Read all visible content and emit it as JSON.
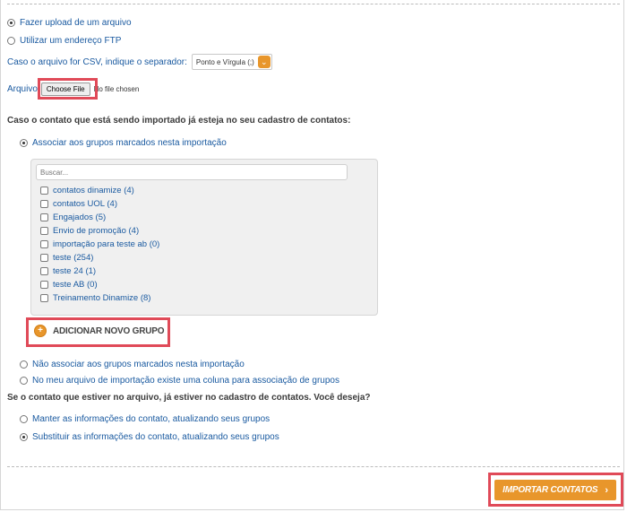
{
  "upload": {
    "option_upload": "Fazer upload de um arquivo",
    "option_ftp": "Utilizar um endereço FTP",
    "separator_label": "Caso o arquivo for CSV, indique o separador:",
    "separator_value": "Ponto e Vírgula (;)",
    "file_label": "Arquivo",
    "choose_file": "Choose File",
    "no_file": "No file chosen"
  },
  "existing_contact": {
    "question": "Caso o contato que está sendo importado já esteja no seu cadastro de contatos:",
    "option_associate": "Associar aos grupos marcados nesta importação",
    "search_placeholder": "Buscar...",
    "groups": [
      "contatos dinamize (4)",
      "contatos UOL (4)",
      "Engajados (5)",
      "Envio de promoção (4)",
      "importação para teste ab (0)",
      "teste (254)",
      "teste 24 (1)",
      "teste AB (0)",
      "Treinamento Dinamize (8)"
    ],
    "add_group": "ADICIONAR NOVO GRUPO",
    "option_no_associate": "Não associar aos grupos marcados nesta importação",
    "option_column": "No meu arquivo de importação existe uma coluna para associação de grupos"
  },
  "in_file": {
    "question": "Se o contato que estiver no arquivo, já estiver no cadastro de contatos. Você deseja?",
    "option_keep": "Manter as informações do contato, atualizando seus grupos",
    "option_replace": "Substituir as informações do contato, atualizando seus grupos"
  },
  "footer": {
    "import_button": "IMPORTAR CONTATOS"
  },
  "colors": {
    "accent": "#e8962b",
    "highlight": "#e04a58",
    "link": "#1a5aa0"
  }
}
